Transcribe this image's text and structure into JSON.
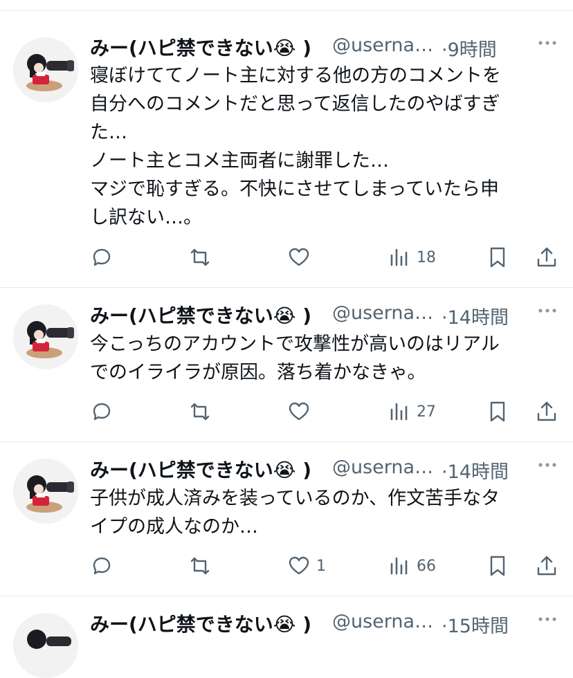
{
  "posts": [
    {
      "name": "みー(ハピ禁できない😭 )",
      "handle": "@userna…",
      "time": "·9時間",
      "text": "寝ぼけててノート主に対する他の方のコメントを\n自分へのコメントだと思って返信したのやばすぎ\nた…\nノート主とコメ主両者に謝罪した…\nマジで恥すぎる。不快にさせてしまっていたら申\nし訳ない…。",
      "likes": "",
      "views": "18"
    },
    {
      "name": "みー(ハピ禁できない😭 )",
      "handle": "@userna…",
      "time": "·14時間",
      "text": "今こっちのアカウントで攻撃性が高いのはリアル\nでのイライラが原因。落ち着かなきゃ。",
      "likes": "",
      "views": "27"
    },
    {
      "name": "みー(ハピ禁できない😭 )",
      "handle": "@userna…",
      "time": "·14時間",
      "text": "子供が成人済みを装っているのか、作文苦手なタ\nイプの成人なのか…",
      "likes": "1",
      "views": "66"
    },
    {
      "name": "みー(ハピ禁できない😭 )",
      "handle": "@userna…",
      "time": "·15時間",
      "text": "",
      "likes": "",
      "views": ""
    }
  ],
  "icons": {
    "reply": "speech-bubble-icon",
    "repost": "repost-arrows-icon",
    "like": "heart-icon",
    "views": "bar-chart-icon",
    "bookmark": "bookmark-icon",
    "share": "share-upload-icon",
    "more": "more-dots-icon"
  },
  "colors": {
    "text": "#0f1419",
    "secondary": "#536471",
    "divider": "#e6e9ec"
  }
}
